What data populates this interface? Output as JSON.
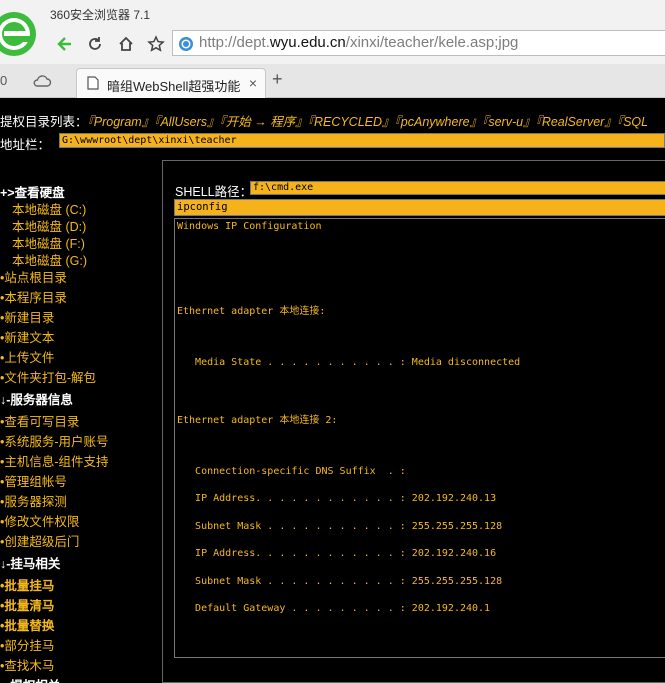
{
  "browser": {
    "app_title": "360安全浏览器 7.1",
    "url_prefix": "http://dept.",
    "url_host": "wyu.edu.cn",
    "url_path": "/xinxi/teacher/kele.asp;jpg",
    "tab_title": "暗组WebShell超强功能",
    "tab_close": "×",
    "new_tab": "+",
    "tab_left_label": "0"
  },
  "web": {
    "menu_prefix": "提权目录列表：",
    "menu_links": [
      "『Program』",
      "『AllUsers』",
      "『开始 → 程序』",
      "『RECYCLED』",
      "『pcAnywhere』",
      "『serv-u』",
      "『RealServer』",
      "『SQL"
    ],
    "addr_label": "地址栏：",
    "addr_value": "G:\\wwwroot\\dept\\xinxi\\teacher",
    "sidebar": {
      "disk_head": "+>查看硬盘",
      "disks": [
        "本地磁盘 (C:)",
        "本地磁盘 (D:)",
        "本地磁盘 (F:)",
        "本地磁盘 (G:)"
      ],
      "links1": [
        "•站点根目录",
        "•本程序目录",
        "•新建目录",
        "•新建文本",
        "•上传文件",
        "•文件夹打包-解包"
      ],
      "server_head": "↓-服务器信息",
      "links2": [
        "•查看可写目录",
        "•系统服务-用户账号",
        "•主机信息-组件支持",
        "•管理组帐号",
        "•服务器探测",
        "•修改文件权限",
        "•创建超级后门"
      ],
      "trojan_head": "↓-挂马相关",
      "links3": [
        "•批量挂马",
        "•批量清马",
        "•批量替换"
      ],
      "links4": [
        "•部分挂马",
        "•查找木马"
      ],
      "priv_head": "↓-提权相关"
    },
    "shell": {
      "label": "SHELL路径：",
      "path": "f:\\cmd.exe",
      "command": "ipconfig"
    },
    "output": [
      "Windows IP Configuration",
      "Ethernet adapter 本地连接:",
      "   Media State . . . . . . . . . . . : Media disconnected",
      "Ethernet adapter 本地连接 2:",
      "   Connection-specific DNS Suffix  . :",
      "   IP Address. . . . . . . . . . . . : 202.192.240.13",
      "   Subnet Mask . . . . . . . . . . . : 255.255.255.128",
      "   IP Address. . . . . . . . . . . . : 202.192.240.16",
      "   Subnet Mask . . . . . . . . . . . : 255.255.255.128",
      "   Default Gateway . . . . . . . . . : 202.192.240.1"
    ]
  },
  "colors": {
    "accent_yellow": "#f5b91c",
    "input_yellow": "#f5b21a",
    "background": "#000000",
    "logo_green": "#3dbb3d"
  }
}
